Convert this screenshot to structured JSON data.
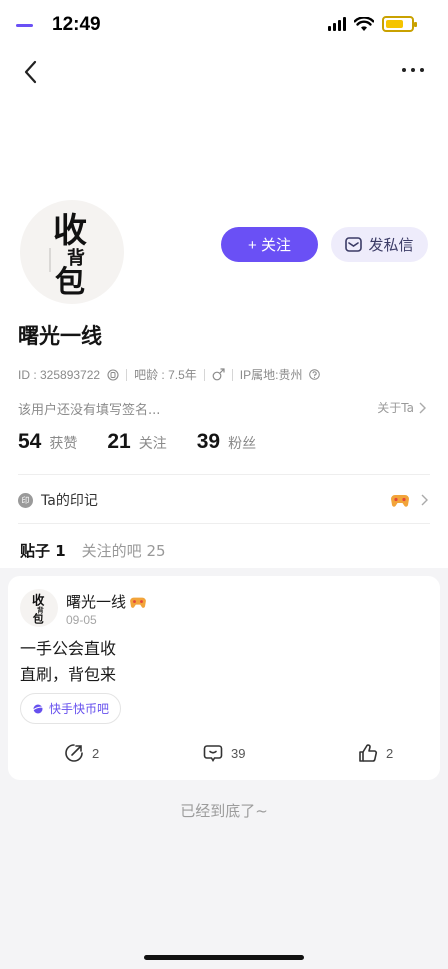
{
  "status": {
    "time": "12:49"
  },
  "profile": {
    "follow_label": "+ 关注",
    "message_label": "发私信",
    "username": "曙光一线",
    "id_text": "ID : 325893722",
    "age_text": "吧龄 : 7.5年",
    "ip_text": "IP属地:贵州",
    "bio": "该用户还没有填写签名...",
    "about_label": "关于Ta",
    "stats": [
      {
        "num": "54",
        "label": "获赞"
      },
      {
        "num": "21",
        "label": "关注"
      },
      {
        "num": "39",
        "label": "粉丝"
      }
    ],
    "badges_label": "Ta的印记",
    "badge_icon_text": "印"
  },
  "avatar_logo": {
    "main1": "收",
    "main2": "背",
    "main3": "包"
  },
  "tabs": [
    {
      "label": "贴子 1",
      "active": true
    },
    {
      "label": "关注的吧 25",
      "active": false
    }
  ],
  "post": {
    "author": "曙光一线",
    "date": "09-05",
    "lines": [
      "一手公会直收",
      "直刷，背包来"
    ],
    "forum": "快手快币吧",
    "shares": "2",
    "comments": "39",
    "likes": "2"
  },
  "footer": {
    "end_text": "已经到底了~"
  },
  "colors": {
    "accent": "#6a50f5",
    "accent_light": "#eeecfb"
  }
}
